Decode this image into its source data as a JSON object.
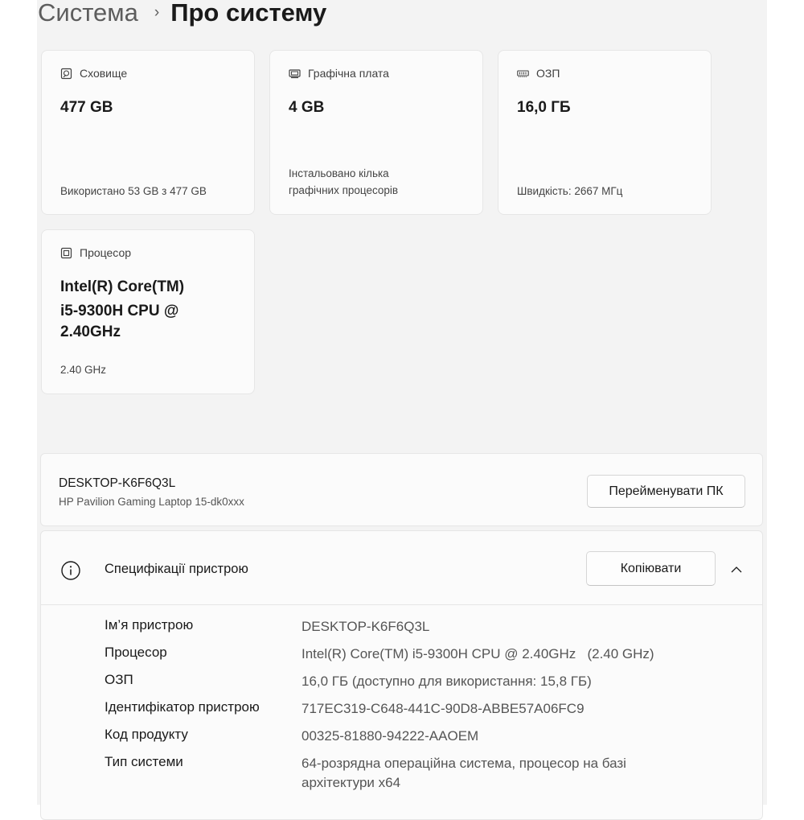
{
  "breadcrumb": {
    "parent": "Система",
    "separator": "›",
    "current": "Про систему"
  },
  "cards": {
    "storage": {
      "icon": "storage-icon",
      "title": "Сховище",
      "value": "477 GB",
      "footer": "Використано 53 GB з 477 GB"
    },
    "graphics": {
      "icon": "graphics-card-icon",
      "title": "Графічна плата",
      "value": "4 GB",
      "footer_line1": "Інстальовано кілька",
      "footer_line2": "графічних процесорів"
    },
    "ram": {
      "icon": "memory-icon",
      "title": "ОЗП",
      "value": "16,0 ГБ",
      "footer": "Швидкість: 2667 МГц"
    },
    "processor": {
      "icon": "processor-icon",
      "title": "Процесор",
      "value_line1": "Intel(R) Core(TM)",
      "value_line2": "i5-9300H CPU @",
      "value_line3": "2.40GHz",
      "footer": "2.40 GHz"
    }
  },
  "device": {
    "name": "DESKTOP-K6F6Q3L",
    "model": "HP Pavilion Gaming Laptop 15-dk0xxx",
    "rename_button": "Перейменувати ПК"
  },
  "specs": {
    "icon": "info-icon",
    "title": "Специфікації пристрою",
    "copy_button": "Копіювати",
    "collapse_icon": "chevron-up-icon",
    "rows": [
      {
        "label": "Ім’я пристрою",
        "value": "DESKTOP-K6F6Q3L"
      },
      {
        "label": "Процесор",
        "value": "Intel(R) Core(TM) i5-9300H CPU @ 2.40GHz   (2.40 GHz)"
      },
      {
        "label": "ОЗП",
        "value": "16,0 ГБ (доступно для використання: 15,8 ГБ)"
      },
      {
        "label": "Ідентифікатор пристрою",
        "value": "717EC319-C648-441C-90D8-ABBE57A06FC9"
      },
      {
        "label": "Код продукту",
        "value": "00325-81880-94222-AAOEM"
      },
      {
        "label": "Тип системи",
        "value": "64-розрядна операційна система, процесор на базі архітектури x64"
      }
    ]
  },
  "colors": {
    "panel_background": "#f3f3f3",
    "card_background": "#fbfbfb",
    "card_border": "#e6e6e6",
    "secondary_text": "#555555"
  }
}
